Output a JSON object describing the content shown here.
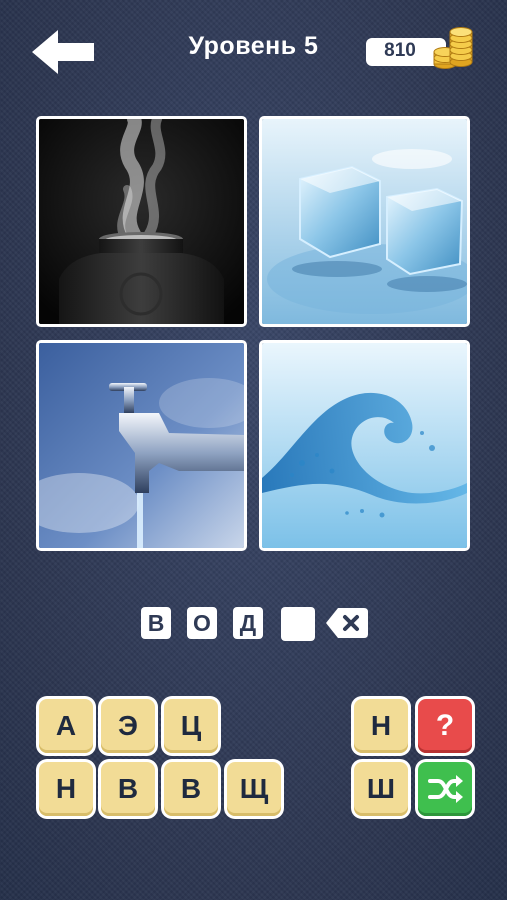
{
  "header": {
    "title": "Уровень 5",
    "coins": "810"
  },
  "icons": {
    "back": "back-arrow-icon",
    "coins": "coin-stack-icon",
    "backspace": "backspace-icon",
    "hint": "question-icon",
    "shuffle": "shuffle-icon"
  },
  "pictures": [
    "steaming pot",
    "ice cubes",
    "water tap",
    "water wave"
  ],
  "answer": {
    "letters": [
      "В",
      "О",
      "Д",
      ""
    ]
  },
  "tiles": {
    "left_row1": [
      "А",
      "Э",
      "Ц"
    ],
    "left_row2": [
      "Н",
      "В",
      "В",
      "Щ"
    ],
    "right": [
      "Н",
      "Ш"
    ]
  },
  "helpers": {
    "hint_label": "?"
  },
  "colors": {
    "background": "#2f3a55",
    "tile": "#f2dc96",
    "hint": "#e84b4b",
    "shuffle": "#3fbf4e"
  }
}
